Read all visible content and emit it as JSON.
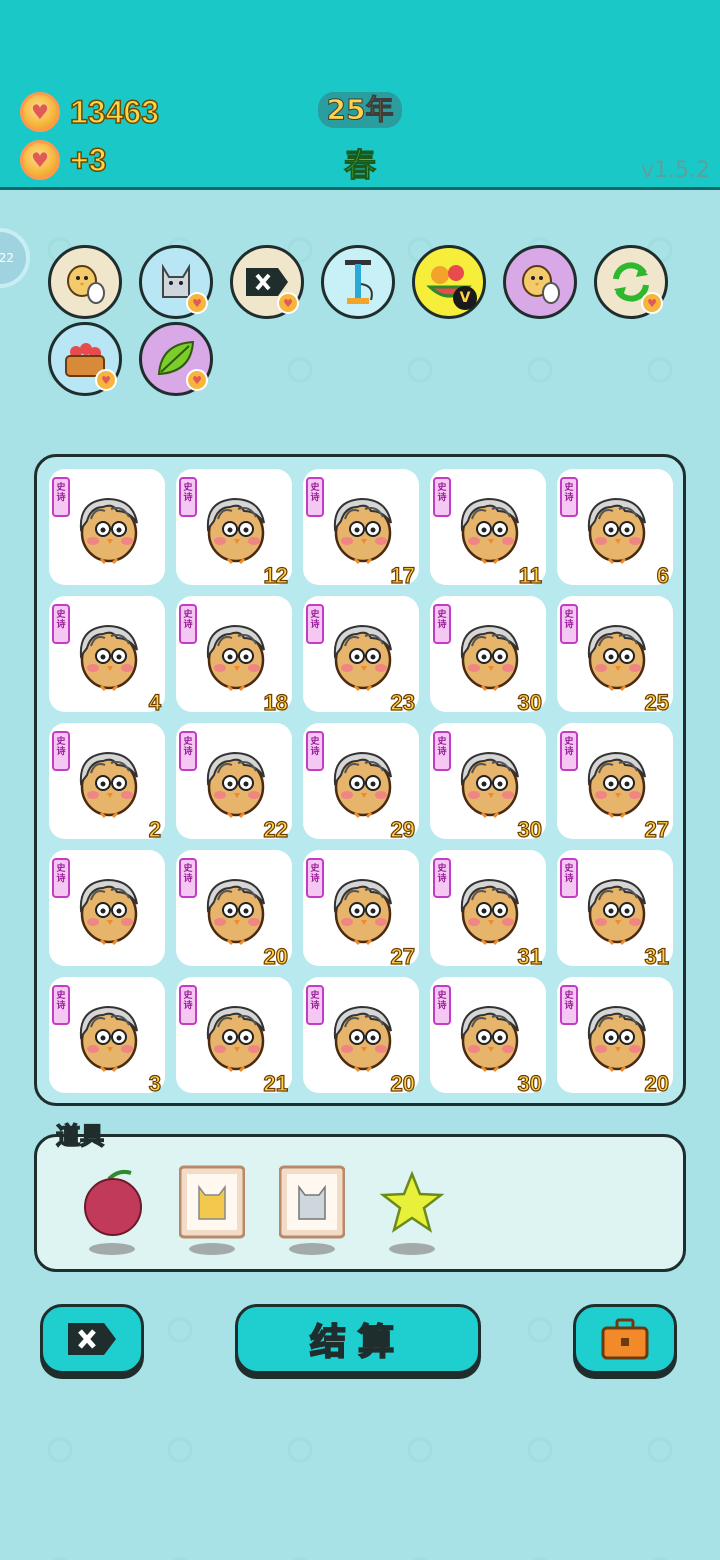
{
  "header": {
    "coins": "13463",
    "coin_rate": "+3",
    "year": "25年",
    "season": "春",
    "version": "v1.5.2",
    "side_tab_label": "22"
  },
  "tools": [
    {
      "name": "chick-egg-tool",
      "icon": "chick-egg-icon"
    },
    {
      "name": "husky-tool",
      "icon": "husky-icon"
    },
    {
      "name": "remove-tool",
      "icon": "remove-tag-icon"
    },
    {
      "name": "pump-tool",
      "icon": "pump-icon"
    },
    {
      "name": "fruit-vip-tool",
      "icon": "fruit-basket-icon",
      "badge": "V"
    },
    {
      "name": "chick-egg-tool-2",
      "icon": "chick-egg-icon"
    },
    {
      "name": "refresh-tool",
      "icon": "refresh-icon"
    },
    {
      "name": "fruit-basket-tool",
      "icon": "fruit-basket-icon"
    },
    {
      "name": "leaf-tool",
      "icon": "leaf-icon"
    }
  ],
  "grid": {
    "tag": "史诗",
    "cells": [
      "",
      "12",
      "17",
      "11",
      "6",
      "4",
      "18",
      "23",
      "30",
      "25",
      "2",
      "22",
      "29",
      "30",
      "27",
      "",
      "20",
      "27",
      "31",
      "31",
      "3",
      "21",
      "20",
      "30",
      "20"
    ]
  },
  "items": {
    "label": "道具",
    "list": [
      {
        "icon": "bayberry-icon"
      },
      {
        "icon": "cat-portrait-icon"
      },
      {
        "icon": "husky-portrait-icon"
      },
      {
        "icon": "star-icon"
      }
    ]
  },
  "buttons": {
    "settle": "结算"
  },
  "colors": {
    "header": "#1ac8c8",
    "background": "#a9e2e6",
    "number": "#ffd34a",
    "button": "#1fcfcf"
  }
}
